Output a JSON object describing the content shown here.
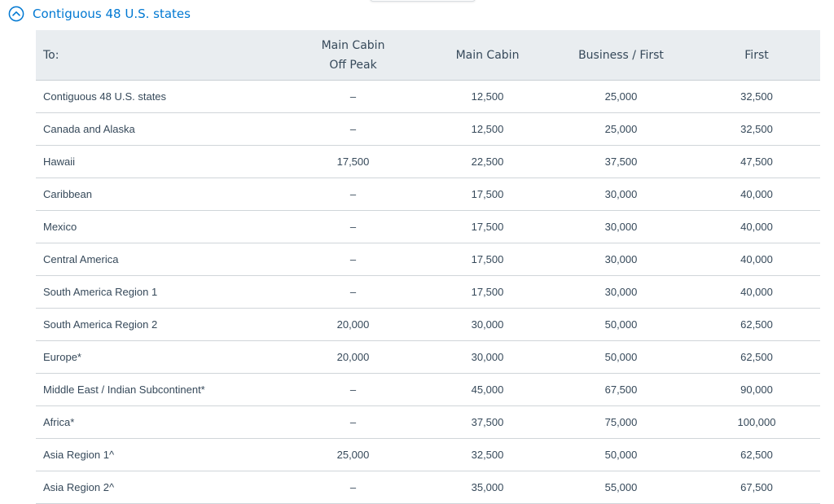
{
  "accordion": {
    "title": "Contiguous 48 U.S. states",
    "expanded": true,
    "icon": "chevron-up-circle-icon",
    "accent_color": "#0078d2"
  },
  "table": {
    "header_bg": "#e9edf0",
    "columns": [
      {
        "key": "dest",
        "label": "To:"
      },
      {
        "key": "mcop",
        "label_line1": "Main Cabin",
        "label_line2": "Off Peak"
      },
      {
        "key": "mc",
        "label": "Main Cabin"
      },
      {
        "key": "bf",
        "label": "Business / First"
      },
      {
        "key": "first",
        "label": "First"
      }
    ],
    "rows": [
      {
        "dest": "Contiguous 48 U.S. states",
        "mcop": "–",
        "mc": "12,500",
        "bf": "25,000",
        "first": "32,500"
      },
      {
        "dest": "Canada and Alaska",
        "mcop": "–",
        "mc": "12,500",
        "bf": "25,000",
        "first": "32,500"
      },
      {
        "dest": "Hawaii",
        "mcop": "17,500",
        "mc": "22,500",
        "bf": "37,500",
        "first": "47,500"
      },
      {
        "dest": "Caribbean",
        "mcop": "–",
        "mc": "17,500",
        "bf": "30,000",
        "first": "40,000"
      },
      {
        "dest": "Mexico",
        "mcop": "–",
        "mc": "17,500",
        "bf": "30,000",
        "first": "40,000"
      },
      {
        "dest": "Central America",
        "mcop": "–",
        "mc": "17,500",
        "bf": "30,000",
        "first": "40,000"
      },
      {
        "dest": "South America Region 1",
        "mcop": "–",
        "mc": "17,500",
        "bf": "30,000",
        "first": "40,000"
      },
      {
        "dest": "South America Region 2",
        "mcop": "20,000",
        "mc": "30,000",
        "bf": "50,000",
        "first": "62,500"
      },
      {
        "dest": "Europe*",
        "mcop": "20,000",
        "mc": "30,000",
        "bf": "50,000",
        "first": "62,500"
      },
      {
        "dest": "Middle East / Indian Subcontinent*",
        "mcop": "–",
        "mc": "45,000",
        "bf": "67,500",
        "first": "90,000"
      },
      {
        "dest": "Africa*",
        "mcop": "–",
        "mc": "37,500",
        "bf": "75,000",
        "first": "100,000"
      },
      {
        "dest": "Asia Region 1^",
        "mcop": "25,000",
        "mc": "32,500",
        "bf": "50,000",
        "first": "62,500"
      },
      {
        "dest": "Asia Region 2^",
        "mcop": "–",
        "mc": "35,000",
        "bf": "55,000",
        "first": "67,500"
      }
    ]
  }
}
